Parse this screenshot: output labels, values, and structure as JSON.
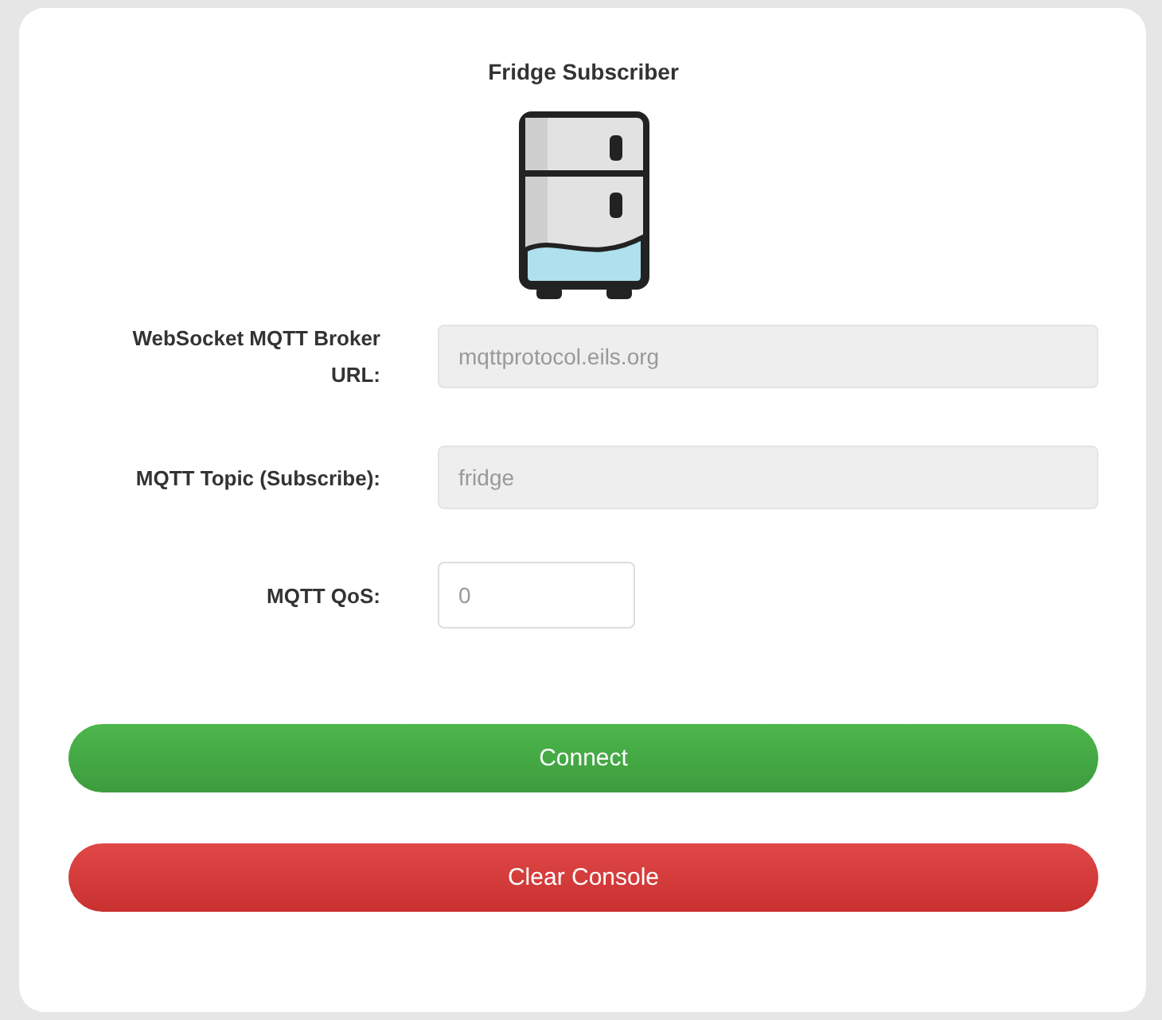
{
  "title": "Fridge Subscriber",
  "fields": [
    {
      "label": "WebSocket MQTT Broker URL:",
      "value": "mqttprotocol.eils.org",
      "disabled": true,
      "kind": "wide"
    },
    {
      "label": "MQTT Topic (Subscribe):",
      "value": "fridge",
      "disabled": true,
      "kind": "wide"
    },
    {
      "label": "MQTT QoS:",
      "value": "0",
      "disabled": false,
      "kind": "short"
    }
  ],
  "buttons": [
    {
      "label": "Connect",
      "kind": "success"
    },
    {
      "label": "Clear Console",
      "kind": "danger"
    }
  ]
}
